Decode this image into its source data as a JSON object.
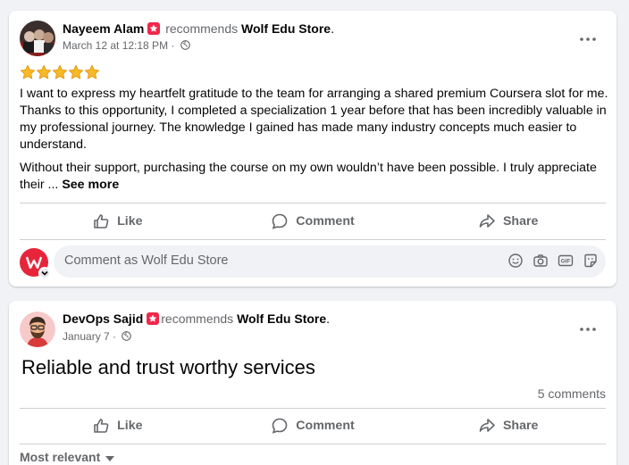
{
  "posts": [
    {
      "author": "Nayeem Alam",
      "recommends": "recommends",
      "page": "Wolf Edu Store",
      "period": ".",
      "time": "March 12 at 12:18 PM",
      "separator": "·",
      "rating_stars": 5,
      "paragraph1": "I want to express my heartfelt gratitude to the team for arranging a shared premium Coursera slot for me. Thanks to this opportunity, I completed a specialization 1 year before that has been incredibly valuable in my professional journey. The knowledge I gained has made many industry concepts much easier to understand.",
      "paragraph2": "Without their support, purchasing the course on my own wouldn’t have been possible. I truly appreciate their ...",
      "see_more": "See more",
      "actions": {
        "like": "Like",
        "comment": "Comment",
        "share": "Share"
      },
      "comment_placeholder": "Comment as Wolf Edu Store"
    },
    {
      "author": "DevOps Sajid",
      "recommends": "recommends",
      "page": "Wolf Edu Store",
      "period": ".",
      "time": "January 7",
      "separator": "·",
      "text": "Reliable and trust worthy services",
      "comments_count": "5 comments",
      "actions": {
        "like": "Like",
        "comment": "Comment",
        "share": "Share"
      },
      "sort_label": "Most relevant"
    }
  ],
  "colors": {
    "brand_red": "#e7253a",
    "recommend_badge": "#f02849",
    "secondary_text": "#65676b",
    "star": "#f7b928"
  },
  "icons": [
    "recommend-badge-icon",
    "globe-icon",
    "more-icon",
    "star-icon",
    "like-icon",
    "comment-icon",
    "share-icon",
    "emoji-icon",
    "camera-icon",
    "gif-icon",
    "sticker-icon",
    "caret-down-icon"
  ]
}
